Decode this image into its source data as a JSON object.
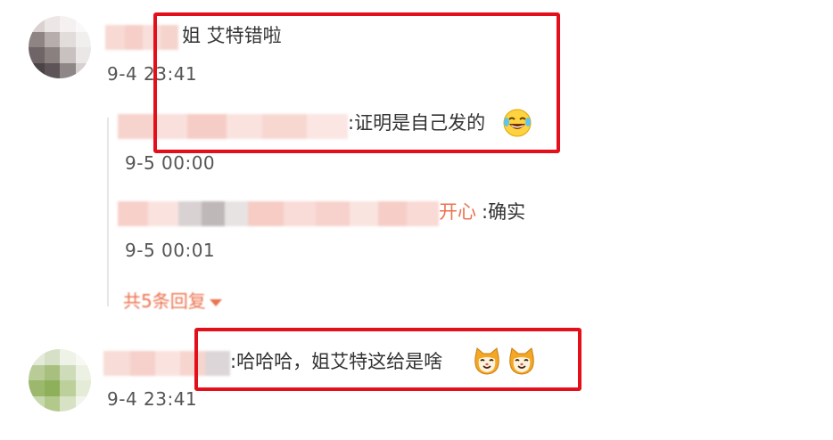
{
  "comment1": {
    "text": "姐 艾特错啦",
    "time": "9-4 23:41"
  },
  "replies": [
    {
      "text": ":证明是自己发的",
      "time": "9-5 00:00"
    },
    {
      "username_tail": "开心",
      "text": ":确实",
      "time": "9-5 00:01"
    }
  ],
  "more_replies_label": "共5条回复",
  "comment2": {
    "text": ":哈哈哈，姐艾特这给是啥",
    "time": "9-4 23:41"
  },
  "colors": {
    "highlight_box": "#e3101b",
    "username": "#eb7350"
  },
  "icons": [
    "laugh-cry-emoji-icon",
    "cat-emoji-icon",
    "cat-emoji-icon",
    "chevron-down-icon"
  ]
}
